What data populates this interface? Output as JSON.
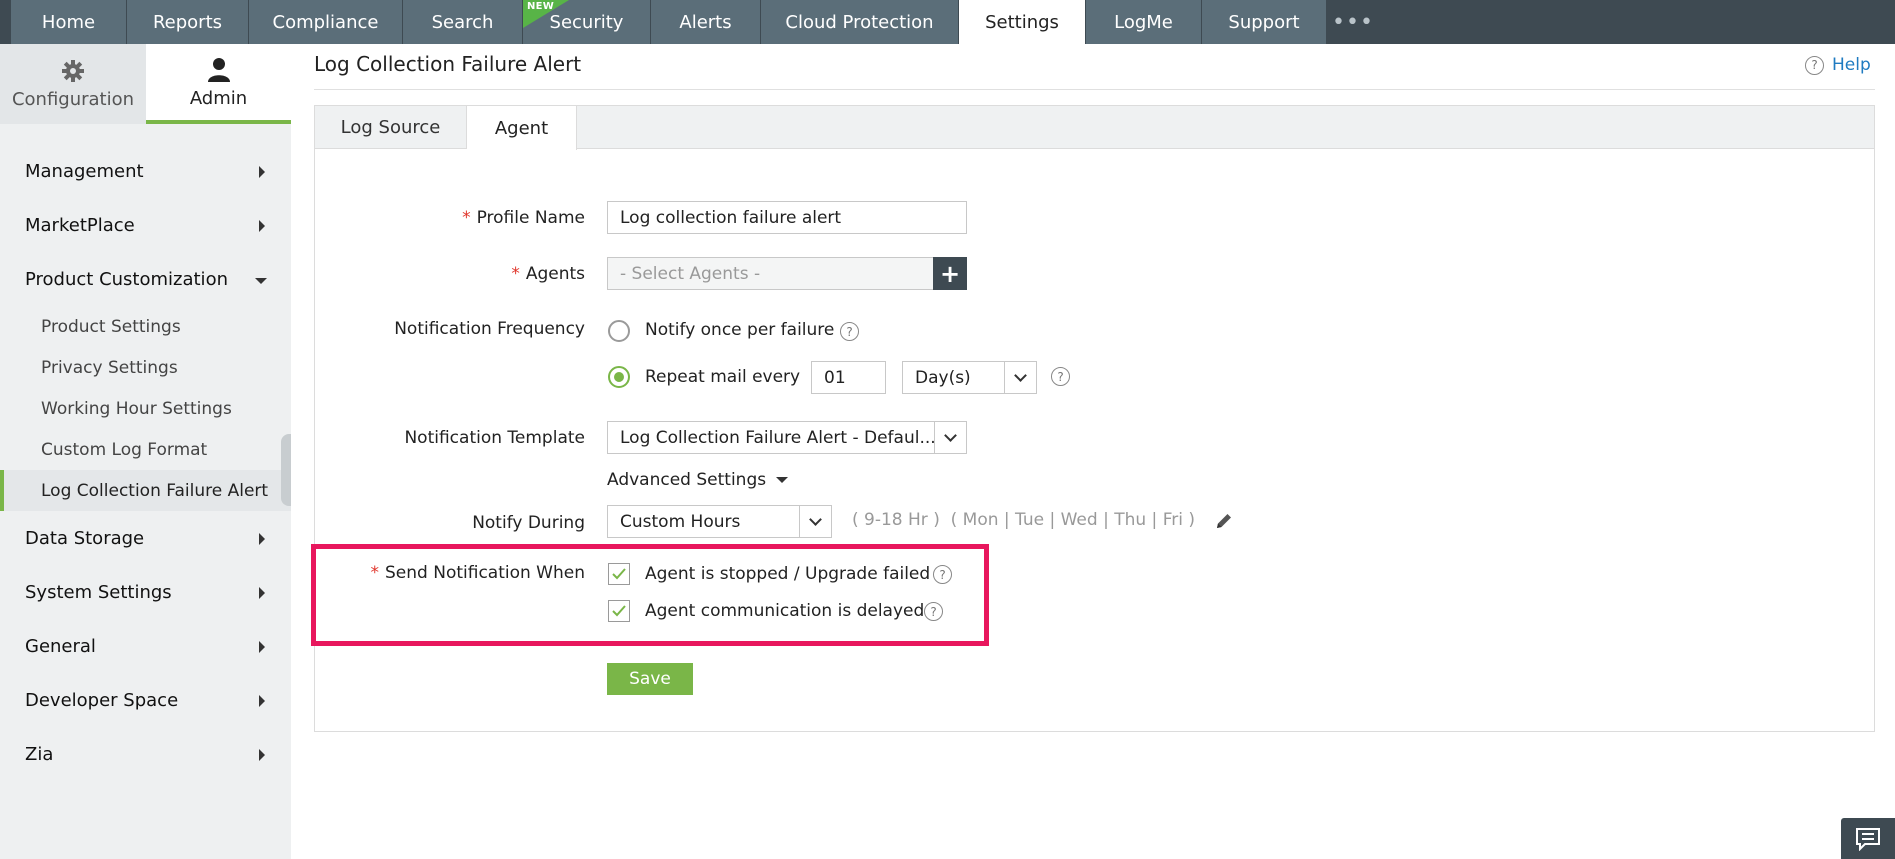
{
  "topnav": {
    "tabs": [
      {
        "label": "Home"
      },
      {
        "label": "Reports"
      },
      {
        "label": "Compliance"
      },
      {
        "label": "Search"
      },
      {
        "label": "Security",
        "badge": "NEW"
      },
      {
        "label": "Alerts"
      },
      {
        "label": "Cloud Protection"
      },
      {
        "label": "Settings",
        "active": true
      },
      {
        "label": "LogMe"
      },
      {
        "label": "Support"
      }
    ],
    "more": "•••"
  },
  "sidebar": {
    "config_tab": "Configuration",
    "admin_tab": "Admin",
    "menu": [
      {
        "label": "Management"
      },
      {
        "label": "MarketPlace"
      },
      {
        "label": "Product Customization",
        "expanded": true,
        "children": [
          "Product Settings",
          "Privacy Settings",
          "Working Hour Settings",
          "Custom Log Format",
          "Log Collection Failure Alert"
        ]
      },
      {
        "label": "Data Storage"
      },
      {
        "label": "System Settings"
      },
      {
        "label": "General"
      },
      {
        "label": "Developer Space"
      },
      {
        "label": "Zia"
      }
    ],
    "active_child": "Log Collection Failure Alert"
  },
  "page": {
    "title": "Log Collection Failure Alert",
    "help": "Help"
  },
  "tabs": {
    "log_source": "Log Source",
    "agent": "Agent"
  },
  "form": {
    "required_mark": "*",
    "profile_name_label": "Profile Name",
    "profile_name_value": "Log collection failure alert",
    "agents_label": "Agents",
    "agents_placeholder": "- Select Agents -",
    "agents_add": "+",
    "freq_label": "Notification Frequency",
    "freq_once": "Notify once per failure",
    "freq_repeat": "Repeat mail every",
    "freq_repeat_value": "01",
    "freq_unit": "Day(s)",
    "template_label": "Notification Template",
    "template_value": "Log Collection Failure Alert - Defaul...",
    "advanced": "Advanced Settings",
    "notify_during_label": "Notify During",
    "notify_during_value": "Custom Hours",
    "hours_info": "( 9-18 Hr )  ( Mon | Tue | Wed | Thu | Fri )",
    "send_when_label": "Send Notification When",
    "check_stopped": "Agent is stopped / Upgrade failed",
    "check_delayed": "Agent communication is delayed",
    "save": "Save",
    "qmark": "?"
  },
  "colors": {
    "nav_bg": "#3e4a52",
    "nav_tab": "#5b6e79",
    "accent_green": "#7ab648",
    "required_red": "#e0352b",
    "highlight": "#e8175d",
    "link_blue": "#1f7bc1"
  }
}
